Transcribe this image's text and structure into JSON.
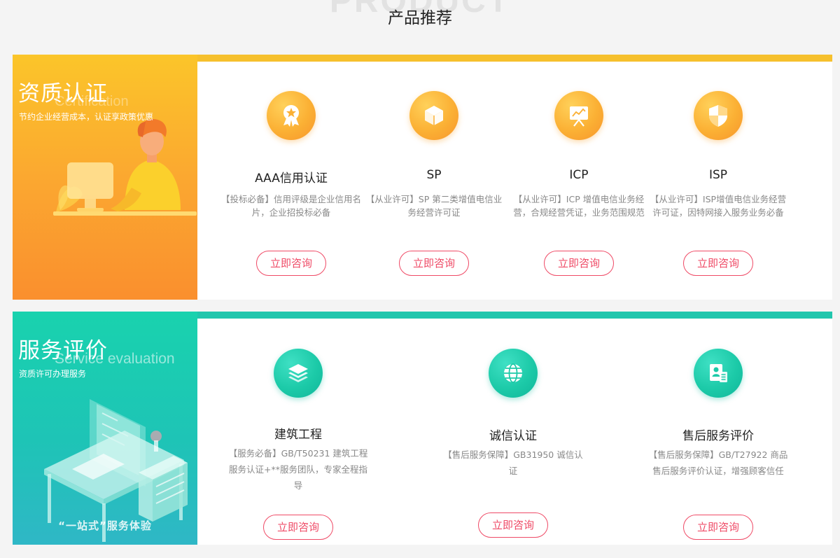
{
  "header": {
    "watermark": "PRODUCT",
    "title": "产品推荐"
  },
  "sections": [
    {
      "title": "资质认证",
      "subtitle_en": "Certification",
      "subtitle": "节约企业经营成本，认证享政策优惠",
      "accent": "#f6c02d",
      "cards": [
        {
          "icon": "award-medal-icon",
          "title": "AAA信用认证",
          "desc": "【投标必备】信用评级是企业信用名片，企业招投标必备",
          "button": "立即咨询"
        },
        {
          "icon": "cube-box-icon",
          "title": "SP",
          "desc": "【从业许可】SP 第二类增值电信业务经营许可证",
          "button": "立即咨询"
        },
        {
          "icon": "presentation-board-icon",
          "title": "ICP",
          "desc": "【从业许可】ICP 增值电信业务经营，合规经营凭证，业务范围规范",
          "button": "立即咨询"
        },
        {
          "icon": "shield-icon",
          "title": "ISP",
          "desc": "【从业许可】ISP增值电信业务经营许可证，因特网接入服务业务必备",
          "button": "立即咨询"
        }
      ]
    },
    {
      "title": "服务评价",
      "subtitle_en": "Service evaluation",
      "subtitle": "资质许可办理服务",
      "caption": "“一站式”服务体验",
      "accent": "#21c6ad",
      "cards": [
        {
          "icon": "layers-icon",
          "title": "建筑工程",
          "desc": "【服务必备】GB/T50231 建筑工程服务认证+**服务团队，专家全程指导",
          "button": "立即咨询"
        },
        {
          "icon": "globe-icon",
          "title": "诚信认证",
          "desc": "【售后服务保障】GB31950 诚信认证",
          "button": "立即咨询"
        },
        {
          "icon": "id-card-icon",
          "title": "售后服务评价",
          "desc": "【售后服务保障】GB/T27922 商品售后服务评价认证，增强顾客信任",
          "button": "立即咨询"
        }
      ]
    }
  ]
}
